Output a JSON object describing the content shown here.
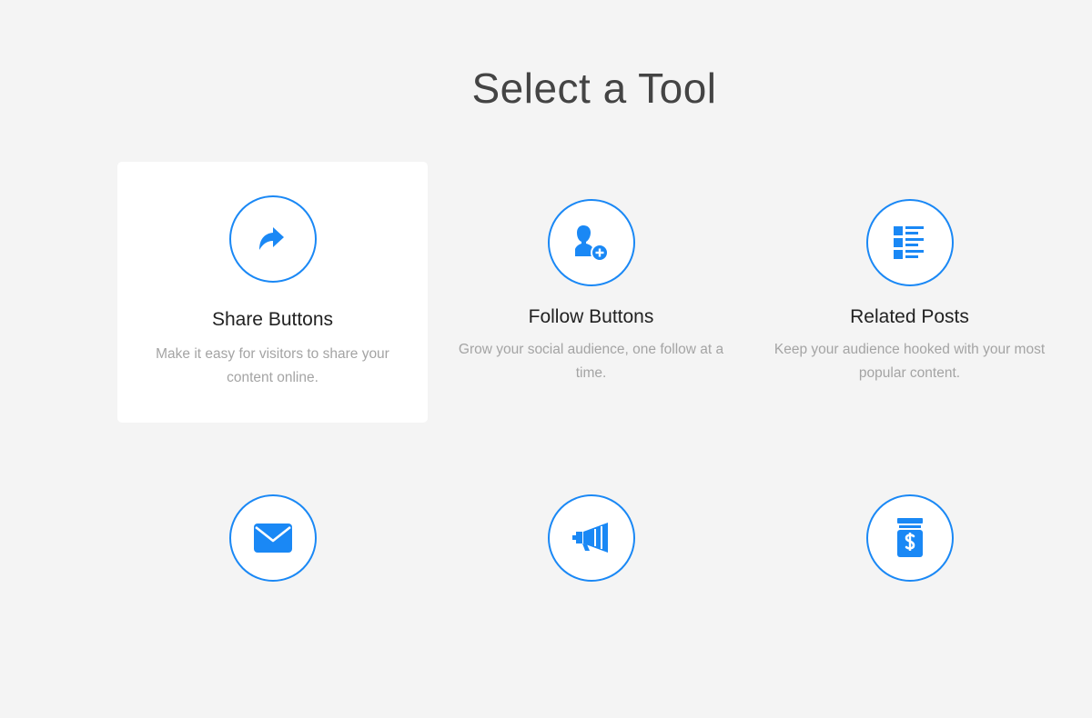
{
  "page": {
    "title": "Select a Tool"
  },
  "tools": [
    {
      "name": "Share Buttons",
      "description": "Make it easy for visitors to share your content online.",
      "icon": "share-arrow-icon",
      "selected": true
    },
    {
      "name": "Follow Buttons",
      "description": "Grow your social audience, one follow at a time.",
      "icon": "add-follower-icon",
      "selected": false
    },
    {
      "name": "Related Posts",
      "description": "Keep your audience hooked with your most popular content.",
      "icon": "list-icon",
      "selected": false
    },
    {
      "icon": "envelope-icon"
    },
    {
      "icon": "megaphone-icon"
    },
    {
      "icon": "money-jar-icon"
    }
  ],
  "colors": {
    "accent": "#1a88f5",
    "background": "#f4f4f4",
    "card_selected": "#ffffff",
    "title": "#444444",
    "description": "#a4a4a4"
  }
}
